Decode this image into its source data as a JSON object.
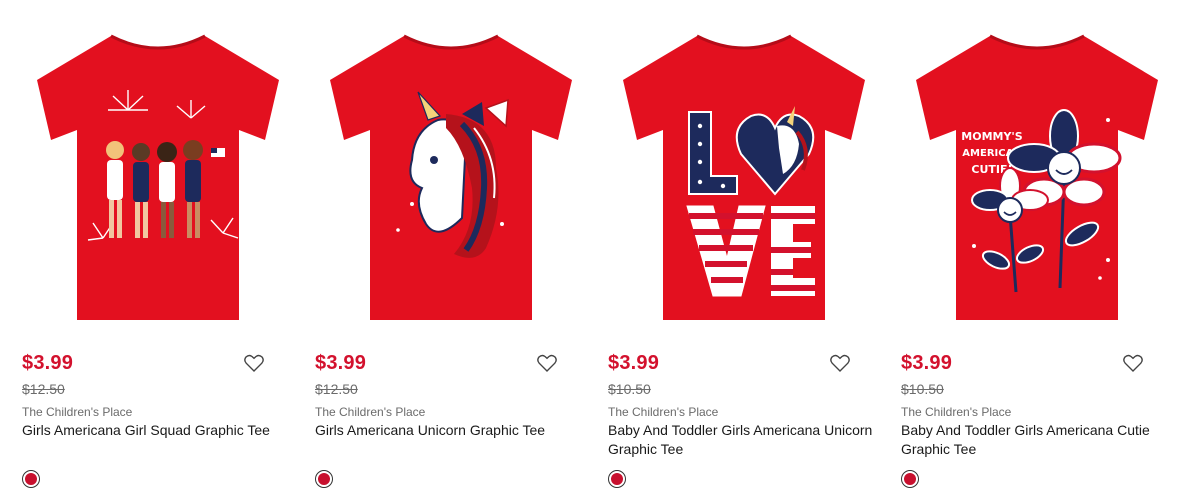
{
  "accent_color": "#d3112d",
  "products": [
    {
      "price": "$3.99",
      "original_price": "$12.50",
      "brand": "The Children's Place",
      "title": "Girls Americana Girl Squad Graphic Tee",
      "graphic": "girl-squad",
      "shirt_color": "#e3101f",
      "swatch_color": "#c8102e",
      "icon": "heart-icon"
    },
    {
      "price": "$3.99",
      "original_price": "$12.50",
      "brand": "The Children's Place",
      "title": "Girls Americana Unicorn Graphic Tee",
      "graphic": "unicorn",
      "shirt_color": "#e3101f",
      "swatch_color": "#c8102e",
      "icon": "heart-icon"
    },
    {
      "price": "$3.99",
      "original_price": "$10.50",
      "brand": "The Children's Place",
      "title": "Baby And Toddler Girls Americana Unicorn Graphic Tee",
      "graphic": "love",
      "shirt_color": "#e3101f",
      "swatch_color": "#c8102e",
      "icon": "heart-icon"
    },
    {
      "price": "$3.99",
      "original_price": "$10.50",
      "brand": "The Children's Place",
      "title": "Baby And Toddler Girls Americana Cutie Graphic Tee",
      "graphic": "mommys-cutie",
      "graphic_text": [
        "MOMMY'S",
        "AMERICAN",
        "CUTIE!"
      ],
      "shirt_color": "#e3101f",
      "swatch_color": "#c8102e",
      "icon": "heart-icon"
    }
  ]
}
